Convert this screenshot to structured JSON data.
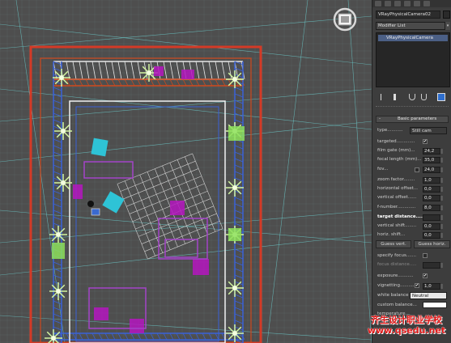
{
  "viewport": {
    "name": "perspective-viewport"
  },
  "command_panel": {
    "object_name": "VRayPhysicalCamera02",
    "modifier_list_label": "Modifier List",
    "stack_item": "VRayPhysicalCamera",
    "rollout_title": "Basic parameters",
    "rollout_toggle": "-",
    "type_label": "type...........",
    "type_value": "Still cam",
    "targeted_label": "targeted.............",
    "targeted_checked": "✔",
    "film_gate_label": "film gate (mm)...",
    "film_gate_value": "24,2",
    "focal_length_label": "focal length (mm)...",
    "focal_length_value": "35,0",
    "fov_label": "fov...",
    "fov_value": "24,0",
    "zoom_factor_label": "zoom factor........",
    "zoom_factor_value": "1,0",
    "horizontal_offset_label": "horizontal offset...",
    "horizontal_offset_value": "0,0",
    "vertical_offset_label": "vertical offset......",
    "vertical_offset_value": "0,0",
    "f_number_label": "f-number.............",
    "f_number_value": "8,0",
    "target_distance_label": "target distance.....",
    "vertical_shift_label": "vertical shift........",
    "vertical_shift_value": "0,0",
    "horizontal_shift_label": "horiz. shift...",
    "horizontal_shift_value": "0,0",
    "guess_vert_label": "Guess vert.",
    "guess_horiz_label": "Guess horiz.",
    "specify_focus_label": "specify focus.......",
    "focus_distance_label": "focus distance.....",
    "exposure_label": "exposure...........",
    "exposure_checked": "✔",
    "vignetting_label": "vignetting.............",
    "vignetting_checked": "✔",
    "vignetting_value": "1,0",
    "white_balance_label": "white balance",
    "white_balance_value": "Neutral",
    "custom_balance_label": "custom balance...",
    "temperature_label": "temperature..."
  },
  "watermark": {
    "line1": "齐生设计职业学校",
    "line2": "www.qsedu.net"
  },
  "colors": {
    "viewport_bg": "#4e4e4e",
    "grid": "#6dd3d3",
    "truss_blue": "#3a62d8",
    "truss_orange": "#d04a1e",
    "stage_edge": "#d43a26",
    "magenta": "#b516c0",
    "green": "#8de05a",
    "cyan": "#2ec3d6",
    "panel_bg": "#3d3d3d",
    "watermark": "#e01818"
  }
}
